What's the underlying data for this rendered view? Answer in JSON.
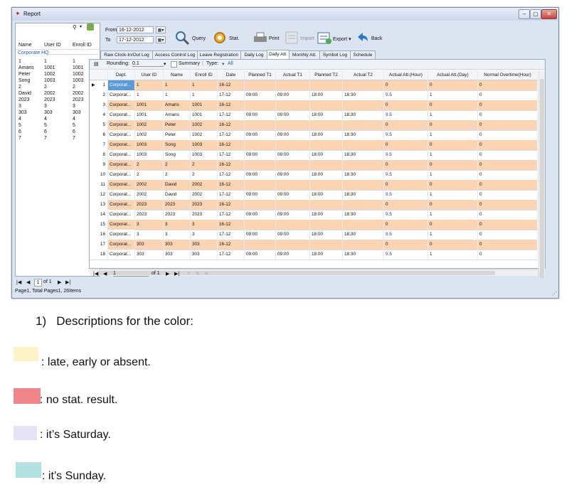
{
  "window": {
    "title": "Report",
    "min": "–",
    "max": "▢",
    "close": "✕"
  },
  "left_panel": {
    "search_icon": "magnifier-icon",
    "dropdown": "▾",
    "columns": [
      "Name",
      "User ID",
      "Enroll ID"
    ],
    "group": "Corporate HQ",
    "rows": [
      [
        "1",
        "1",
        "1"
      ],
      [
        "Amaris",
        "1001",
        "1001"
      ],
      [
        "Peter",
        "1002",
        "1002"
      ],
      [
        "Song",
        "1003",
        "1003"
      ],
      [
        "2",
        "2",
        "2"
      ],
      [
        "David",
        "2002",
        "2002"
      ],
      [
        "2023",
        "2023",
        "2023"
      ],
      [
        "3",
        "3",
        "3"
      ],
      [
        "303",
        "303",
        "303"
      ],
      [
        "4",
        "4",
        "4"
      ],
      [
        "5",
        "5",
        "5"
      ],
      [
        "6",
        "6",
        "6"
      ],
      [
        "7",
        "7",
        "7"
      ]
    ],
    "pager": {
      "first": "|◀",
      "prev": "◀",
      "page": "1",
      "of": "of 1",
      "next": "▶",
      "last": "▶|"
    },
    "status": "Page1, Total Pages1, 26Items"
  },
  "topbar": {
    "from_label": "From",
    "from_value": "16-12-2012",
    "to_label": "To",
    "to_value": "17-12-2012",
    "date_btn": "▦▾",
    "tools": [
      {
        "label": "Query",
        "icon": "query-icon"
      },
      {
        "label": "Stat.",
        "icon": "stat-icon"
      },
      {
        "label": "Print",
        "icon": "print-icon"
      },
      {
        "label": "Import",
        "icon": "import-icon"
      },
      {
        "label": "Export ▾",
        "icon": "export-icon"
      },
      {
        "label": "Back",
        "icon": "back-icon"
      }
    ]
  },
  "tabs": [
    "Raw Clock-In/Out Log",
    "Access Control Log",
    "Leave Registration",
    "Daily Log",
    "Daily Att.",
    "Monthly Att.",
    "Symbol Log",
    "Schedule"
  ],
  "active_tab": "Daily Att.",
  "grid_toolbar": {
    "rounding_label": "Rounding:",
    "rounding_value": "0.1",
    "summary_label": "Summary",
    "type_label": "Type:",
    "type_value": "All"
  },
  "grid": {
    "headers": [
      "Dept.",
      "User ID",
      "Name",
      "Enroll ID",
      "Date",
      "Planned T1",
      "Actual T1",
      "Planned T2",
      "Actual T2",
      "Actual Att.(Hour)",
      "Actual Att.(Day)",
      "Normal Overtime(Hour)"
    ],
    "rows": [
      [
        "1",
        "Corporat...",
        "1",
        "1",
        "1",
        "16-12",
        "",
        "",
        "",
        "",
        "0",
        "0",
        "0"
      ],
      [
        "2",
        "Corporat...",
        "1",
        "1",
        "1",
        "17-12",
        "09:00",
        "09:00",
        "18:00",
        "18:30",
        "9.5",
        "1",
        "0"
      ],
      [
        "3",
        "Corporat...",
        "1001",
        "Amaris",
        "1001",
        "16-12",
        "",
        "",
        "",
        "",
        "0",
        "0",
        "0"
      ],
      [
        "4",
        "Corporat...",
        "1001",
        "Amaris",
        "1001",
        "17-12",
        "09:00",
        "09:00",
        "18:00",
        "18:30",
        "9.5",
        "1",
        "0"
      ],
      [
        "5",
        "Corporat...",
        "1002",
        "Peter",
        "1002",
        "16-12",
        "",
        "",
        "",
        "",
        "0",
        "0",
        "0"
      ],
      [
        "6",
        "Corporat...",
        "1002",
        "Peter",
        "1002",
        "17-12",
        "09:00",
        "09:00",
        "18:00",
        "18:30",
        "9.5",
        "1",
        "0"
      ],
      [
        "7",
        "Corporat...",
        "1003",
        "Song",
        "1003",
        "16-12",
        "",
        "",
        "",
        "",
        "0",
        "0",
        "0"
      ],
      [
        "8",
        "Corporat...",
        "1003",
        "Song",
        "1003",
        "17-12",
        "09:00",
        "09:00",
        "18:00",
        "18:30",
        "9.5",
        "1",
        "0"
      ],
      [
        "9",
        "Corporat...",
        "2",
        "2",
        "2",
        "16-12",
        "",
        "",
        "",
        "",
        "0",
        "0",
        "0"
      ],
      [
        "10",
        "Corporat...",
        "2",
        "2",
        "2",
        "17-12",
        "09:00",
        "09:00",
        "18:00",
        "18:30",
        "9.5",
        "1",
        "0"
      ],
      [
        "11",
        "Corporat...",
        "2002",
        "David",
        "2002",
        "16-12",
        "",
        "",
        "",
        "",
        "0",
        "0",
        "0"
      ],
      [
        "12",
        "Corporat...",
        "2002",
        "David",
        "2002",
        "17-12",
        "09:00",
        "09:00",
        "18:00",
        "18:30",
        "9.5",
        "1",
        "0"
      ],
      [
        "13",
        "Corporat...",
        "2023",
        "2023",
        "2023",
        "16-12",
        "",
        "",
        "",
        "",
        "0",
        "0",
        "0"
      ],
      [
        "14",
        "Corporat...",
        "2023",
        "2023",
        "2023",
        "17-12",
        "09:00",
        "09:00",
        "18:00",
        "18:30",
        "9.5",
        "1",
        "0"
      ],
      [
        "15",
        "Corporat...",
        "3",
        "3",
        "3",
        "16-12",
        "",
        "",
        "",
        "",
        "0",
        "0",
        "0"
      ],
      [
        "16",
        "Corporat...",
        "3",
        "3",
        "3",
        "17-12",
        "09:00",
        "09:00",
        "18:00",
        "18:30",
        "9.5",
        "1",
        "0"
      ],
      [
        "17",
        "Corporat...",
        "303",
        "303",
        "303",
        "16-12",
        "",
        "",
        "",
        "",
        "0",
        "0",
        "0"
      ],
      [
        "18",
        "Corporat...",
        "303",
        "303",
        "303",
        "17-12",
        "09:00",
        "09:00",
        "18:00",
        "18:30",
        "9.5",
        "1",
        "0"
      ]
    ]
  },
  "grid_pager": {
    "first": "|◀",
    "prev": "◀",
    "page": "1",
    "of": "of 1",
    "next": "▶",
    "last": "▶|",
    "add": "+",
    "edit": "✎",
    "del": "✕"
  },
  "colors": {
    "late": "#fef3c7",
    "nostat": "#f0858a",
    "saturday": "#e4e4f6",
    "sunday": "#b3e0e0",
    "row_orange": "#fbd4b4",
    "selected": "#5b9bd5"
  },
  "legend": {
    "title": "1)   Descriptions for the color:",
    "items": [
      {
        "text": ": late, early or absent."
      },
      {
        "text": ": no stat. result."
      },
      {
        "text": ": it’s Saturday."
      },
      {
        "text": ": it’s Sunday."
      }
    ]
  }
}
